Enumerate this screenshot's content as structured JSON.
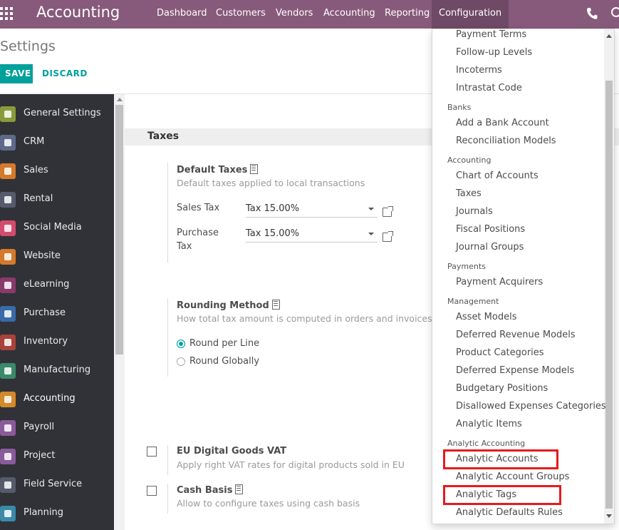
{
  "navbar": {
    "brand": "Accounting",
    "menu": [
      "Dashboard",
      "Customers",
      "Vendors",
      "Accounting",
      "Reporting",
      "Configuration"
    ]
  },
  "control_panel": {
    "title": "Settings",
    "save_label": "SAVE",
    "discard_label": "DISCARD"
  },
  "sidebar": {
    "items": [
      {
        "label": "General Settings",
        "icon": "gear-icon",
        "color": "#8a9a3a"
      },
      {
        "label": "CRM",
        "icon": "handshake-icon",
        "color": "#5d6a8a"
      },
      {
        "label": "Sales",
        "icon": "chart-icon",
        "color": "#d47a2a"
      },
      {
        "label": "Rental",
        "icon": "calendar-icon",
        "color": "#555b6a"
      },
      {
        "label": "Social Media",
        "icon": "thumbs-up-icon",
        "color": "#d34b6e"
      },
      {
        "label": "Website",
        "icon": "globe-icon",
        "color": "#d47a2a"
      },
      {
        "label": "eLearning",
        "icon": "elearning-icon",
        "color": "#8a3a6a"
      },
      {
        "label": "Purchase",
        "icon": "card-icon",
        "color": "#3a6aa8"
      },
      {
        "label": "Inventory",
        "icon": "box-icon",
        "color": "#a8423a"
      },
      {
        "label": "Manufacturing",
        "icon": "wrench-icon",
        "color": "#3a8a6a"
      },
      {
        "label": "Accounting",
        "icon": "dollar-icon",
        "color": "#d4892a"
      },
      {
        "label": "Payroll",
        "icon": "payroll-icon",
        "color": "#8a5a9a"
      },
      {
        "label": "Project",
        "icon": "puzzle-icon",
        "color": "#8a5a9a"
      },
      {
        "label": "Field Service",
        "icon": "field-service-icon",
        "color": "#555b6a"
      },
      {
        "label": "Planning",
        "icon": "planning-icon",
        "color": "#3a8aa8"
      }
    ],
    "selected": "Accounting"
  },
  "taxes": {
    "section_title": "Taxes",
    "default_taxes": {
      "title": "Default Taxes",
      "description": "Default taxes applied to local transactions",
      "sales_label": "Sales Tax",
      "sales_value": "Tax 15.00%",
      "purchase_label_line1": "Purchase",
      "purchase_label_line2": "Tax",
      "purchase_value": "Tax 15.00%"
    },
    "rounding": {
      "title": "Rounding Method",
      "description": "How total tax amount is computed in orders and invoices",
      "options": [
        "Round per Line",
        "Round Globally"
      ],
      "selected": "Round per Line"
    },
    "eu_vat": {
      "title": "EU Digital Goods VAT",
      "description": "Apply right VAT rates for digital products sold in EU",
      "checked": false
    },
    "cash_basis": {
      "title": "Cash Basis",
      "description": "Allow to configure taxes using cash basis",
      "checked": false
    }
  },
  "dropdown": {
    "entries": [
      {
        "type": "item",
        "label": "Payment Terms"
      },
      {
        "type": "item",
        "label": "Follow-up Levels"
      },
      {
        "type": "item",
        "label": "Incoterms"
      },
      {
        "type": "item",
        "label": "Intrastat Code"
      },
      {
        "type": "header",
        "label": "Banks"
      },
      {
        "type": "item",
        "label": "Add a Bank Account"
      },
      {
        "type": "item",
        "label": "Reconciliation Models"
      },
      {
        "type": "header",
        "label": "Accounting"
      },
      {
        "type": "item",
        "label": "Chart of Accounts"
      },
      {
        "type": "item",
        "label": "Taxes"
      },
      {
        "type": "item",
        "label": "Journals"
      },
      {
        "type": "item",
        "label": "Fiscal Positions"
      },
      {
        "type": "item",
        "label": "Journal Groups"
      },
      {
        "type": "header",
        "label": "Payments"
      },
      {
        "type": "item",
        "label": "Payment Acquirers"
      },
      {
        "type": "header",
        "label": "Management"
      },
      {
        "type": "item",
        "label": "Asset Models"
      },
      {
        "type": "item",
        "label": "Deferred Revenue Models"
      },
      {
        "type": "item",
        "label": "Product Categories"
      },
      {
        "type": "item",
        "label": "Deferred Expense Models"
      },
      {
        "type": "item",
        "label": "Budgetary Positions"
      },
      {
        "type": "item",
        "label": "Disallowed Expenses Categories"
      },
      {
        "type": "item",
        "label": "Analytic Items"
      },
      {
        "type": "header",
        "label": "Analytic Accounting"
      },
      {
        "type": "item",
        "label": "Analytic Accounts",
        "highlighted": true
      },
      {
        "type": "item",
        "label": "Analytic Account Groups"
      },
      {
        "type": "item",
        "label": "Analytic Tags",
        "highlighted": true
      },
      {
        "type": "item",
        "label": "Analytic Defaults Rules"
      }
    ],
    "highlight_color": "#e8191c"
  },
  "colors": {
    "navbar": "#875a7b",
    "primary": "#00a09d",
    "sidebar": "#313237"
  }
}
